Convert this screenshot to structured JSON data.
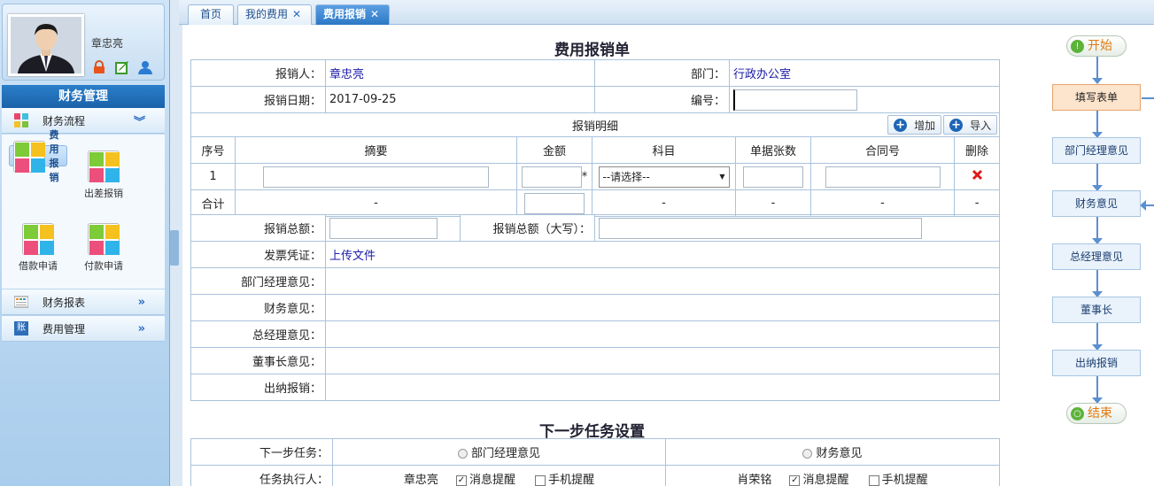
{
  "user": {
    "name": "章忠亮"
  },
  "sidebar": {
    "header": "财务管理",
    "process_label": "财务流程",
    "tiles": [
      {
        "label": "费用报销",
        "selected": true
      },
      {
        "label": "出差报销",
        "selected": false
      },
      {
        "label": "借款申请",
        "selected": false
      },
      {
        "label": "付款申请",
        "selected": false
      }
    ],
    "reports_label": "财务报表",
    "expense_mgmt_label": "费用管理",
    "chevron": "»",
    "chevron_down": "︾",
    "expense_icon_text": "账"
  },
  "tabs": [
    {
      "label": "首页",
      "closable": false,
      "active": false
    },
    {
      "label": "我的费用",
      "closable": true,
      "active": false
    },
    {
      "label": "费用报销",
      "closable": true,
      "active": true
    }
  ],
  "tab_close": "✕",
  "form": {
    "title": "费用报销单",
    "applicant_label": "报销人：",
    "applicant": "章忠亮",
    "dept_label": "部门：",
    "dept": "行政办公室",
    "date_label": "报销日期：",
    "date": "2017-09-25",
    "number_label": "编号：",
    "detail_label": "报销明细",
    "add_btn": "增加",
    "import_btn": "导入",
    "columns": [
      "序号",
      "摘要",
      "金额",
      "科目",
      "单据张数",
      "合同号",
      "删除"
    ],
    "row_index": "1",
    "required_mark": "*",
    "subject_placeholder": "--请选择--",
    "total_label": "合计",
    "dash": "-",
    "sum_label": "报销总额：",
    "sum_upper_label": "报销总额（大写）：",
    "invoice_label": "发票凭证：",
    "upload_link": "上传文件",
    "opinions": [
      "部门经理意见：",
      "财务意见：",
      "总经理意见：",
      "董事长意见：",
      "出纳报销："
    ]
  },
  "next": {
    "title": "下一步任务设置",
    "task_label": "下一步任务：",
    "option1": "部门经理意见",
    "option2": "财务意见",
    "executor_label": "任务执行人：",
    "exec1": "章忠亮",
    "exec2": "肖荣铭",
    "msg_remind": "消息提醒",
    "phone_remind": "手机提醒",
    "check": "✓"
  },
  "flow": {
    "start": "开始",
    "end": "结束",
    "start_glyph": "!",
    "end_glyph": "○",
    "steps": [
      "填写表单",
      "部门经理意见",
      "财务意见",
      "总经理意见",
      "董事长",
      "出纳报销"
    ],
    "current_index": 0
  }
}
